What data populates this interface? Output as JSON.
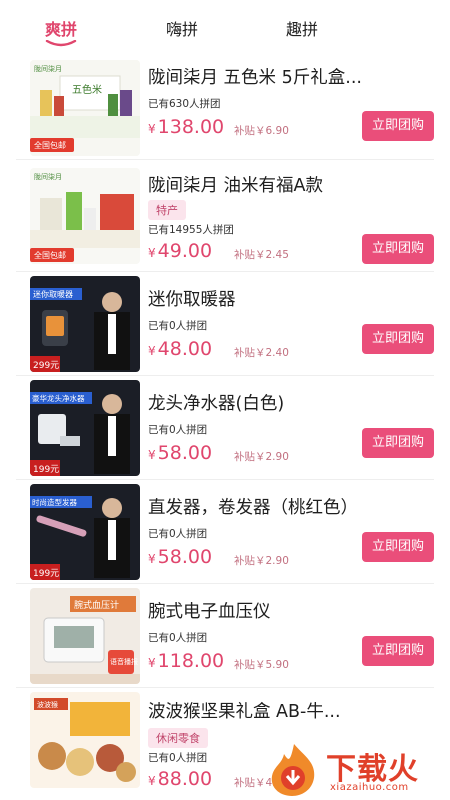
{
  "tabs": [
    {
      "label": "爽拼",
      "active": true
    },
    {
      "label": "嗨拼",
      "active": false
    },
    {
      "label": "趣拼",
      "active": false
    }
  ],
  "colors": {
    "accent": "#e0466d",
    "button": "#ea4e7a",
    "tag_bg": "#fbe4ec"
  },
  "products": [
    {
      "title": "陇间柒月 五色米 5斤礼盒...",
      "tag": "",
      "joined": "已有630人拼团",
      "currency": "¥",
      "price": "138.00",
      "subsidy": "补贴￥6.90",
      "button": "立即团购",
      "badge": "全国包邮",
      "thumb_caption": "五色米",
      "brand": "陇间柒月"
    },
    {
      "title": "陇间柒月 油米有福A款",
      "tag": "特产",
      "joined": "已有14955人拼团",
      "currency": "¥",
      "price": "49.00",
      "subsidy": "补贴￥2.45",
      "button": "立即团购",
      "badge": "全国包邮",
      "thumb_caption": "",
      "brand": "陇间柒月"
    },
    {
      "title": "迷你取暖器",
      "tag": "",
      "joined": "已有0人拼团",
      "currency": "¥",
      "price": "48.00",
      "subsidy": "补贴￥2.40",
      "button": "立即团购",
      "badge": "299元",
      "thumb_caption": "迷你取暖器",
      "brand": ""
    },
    {
      "title": "龙头净水器(白色)",
      "tag": "",
      "joined": "已有0人拼团",
      "currency": "¥",
      "price": "58.00",
      "subsidy": "补贴￥2.90",
      "button": "立即团购",
      "badge": "199元",
      "thumb_caption": "豪华龙头净水器",
      "brand": ""
    },
    {
      "title": "直发器，卷发器（桃红色）",
      "tag": "",
      "joined": "已有0人拼团",
      "currency": "¥",
      "price": "58.00",
      "subsidy": "补贴￥2.90",
      "button": "立即团购",
      "badge": "199元",
      "thumb_caption": "时尚造型发器",
      "brand": ""
    },
    {
      "title": "腕式电子血压仪",
      "tag": "",
      "joined": "已有0人拼团",
      "currency": "¥",
      "price": "118.00",
      "subsidy": "补贴￥5.90",
      "button": "立即团购",
      "badge": "语音播报",
      "thumb_caption": "腕式血压计",
      "brand": ""
    },
    {
      "title": "波波猴坚果礼盒 AB-牛...",
      "tag": "休闲零食",
      "joined": "已有0人拼团",
      "currency": "¥",
      "price": "88.00",
      "subsidy": "补贴￥4.",
      "button": "",
      "badge": "",
      "thumb_caption": "",
      "brand": "波波猴"
    }
  ],
  "watermark": {
    "text": "下载火",
    "url": "xiazaihuo.com"
  }
}
